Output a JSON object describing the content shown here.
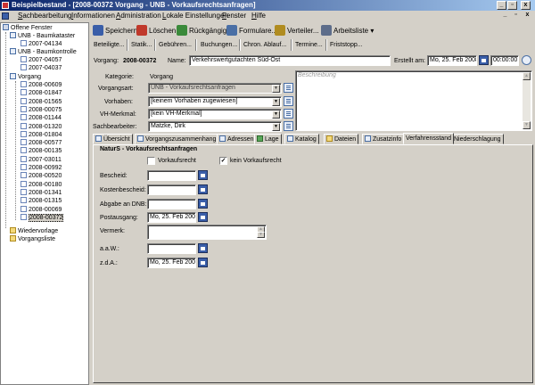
{
  "window": {
    "title": "Beispielbestand - [2008-00372 Vorgang - UNB - Vorkaufsrechtsanfragen]",
    "min": "_",
    "restore": "▫",
    "close": "x"
  },
  "menu": {
    "items": [
      {
        "key": "S",
        "rest": "achbearbeitung"
      },
      {
        "key": "I",
        "rest": "nformationen"
      },
      {
        "key": "A",
        "rest": "dministration"
      },
      {
        "key": "L",
        "rest": "okale Einstellungen"
      },
      {
        "key": "F",
        "rest": "enster"
      },
      {
        "key": "H",
        "rest": "ilfe"
      }
    ]
  },
  "tree": {
    "root": "Offene Fenster",
    "group1": "UNB - Baumkataster",
    "group1_items": [
      "2007-04134"
    ],
    "group2": "UNB - Baumkontrolle",
    "group2_items": [
      "2007-04057",
      "2007-04037"
    ],
    "group3": "Vorgang",
    "group3_items": [
      "2008-00609",
      "2008-01847",
      "2008-01565",
      "2008-00075",
      "2008-01144",
      "2008-01320",
      "2008-01804",
      "2008-00577",
      "2008-00135",
      "2007-03011",
      "2008-00992",
      "2008-00520",
      "2008-00180",
      "2008-01341",
      "2008-01315",
      "2008-00069",
      "2008-00372"
    ],
    "wiedervorlage": "Wiedervorlage",
    "vorgangsliste": "Vorgangsliste"
  },
  "toolbar": {
    "speichern": "Speichern",
    "loeschen": "Löschen",
    "rueckgaengig": "Rückgängig",
    "formulare": "Formulare...",
    "verteiler": "Verteiler...",
    "arbeitsliste": "Arbeitsliste"
  },
  "toolbar2": {
    "items": [
      "Beteiligte...",
      "Statik...",
      "Gebühren...",
      "Buchungen...",
      "Chron. Ablauf...",
      "Termine...",
      "Friststopp..."
    ]
  },
  "form": {
    "vorgang_label": "Vorgang:",
    "vorgang_value": "2008-00372",
    "name_label": "Name:",
    "name_value": "Verkehrswertgutachten Süd-Ost",
    "erstellt_label": "Erstellt am:",
    "erstellt_date": "Mo, 25. Feb 2008",
    "erstellt_time": "00:00:00",
    "kategorie_label": "Kategorie:",
    "kategorie_value": "Vorgang",
    "vorgangsart_label": "Vorgangsart:",
    "vorgangsart_value": "UNB - Vorkaufsrechtsanfragen",
    "vorhaben_label": "Vorhaben:",
    "vorhaben_value": "[keinem Vorhaben zugewiesen]",
    "vhmerkmal_label": "VH-Merkmal:",
    "vhmerkmal_value": "[kein VH-Merkmal]",
    "sachbearbeiter_label": "Sachbearbeiter:",
    "sachbearbeiter_value": "Matzke, Dirk",
    "beschreibung_placeholder": "Beschreibung"
  },
  "tabs": [
    "Übersicht",
    "Vorgangszusammenhang",
    "Adressen",
    "Lage",
    "Katalog",
    "Dateien",
    "Zusatzinfo",
    "Verfahrensstand",
    "Niederschlagung"
  ],
  "active_tab": "Verfahrensstand",
  "panel": {
    "heading": "NaturS - Vorkaufsrechtsanfragen",
    "vorkaufsrecht_label": "Vorkaufsrecht",
    "vorkaufsrecht_checked": false,
    "kein_vorkaufsrecht_label": "kein Vorkaufsrecht",
    "kein_vorkaufsrecht_checked": true,
    "check_mark": "✓",
    "bescheid_label": "Bescheid:",
    "bescheid_value": "",
    "kostenbescheid_label": "Kostenbescheid:",
    "kostenbescheid_value": "",
    "abgabe_label": "Abgabe an DNB:",
    "abgabe_value": "",
    "postausgang_label": "Postausgang:",
    "postausgang_value": "Mo, 25. Feb 2008",
    "vermerk_label": "Vermerk:",
    "aaw_label": "a.a.W.:",
    "aaw_value": "",
    "zda_label": "z.d.A.:",
    "zda_value": "Mo, 25. Feb 2008"
  }
}
